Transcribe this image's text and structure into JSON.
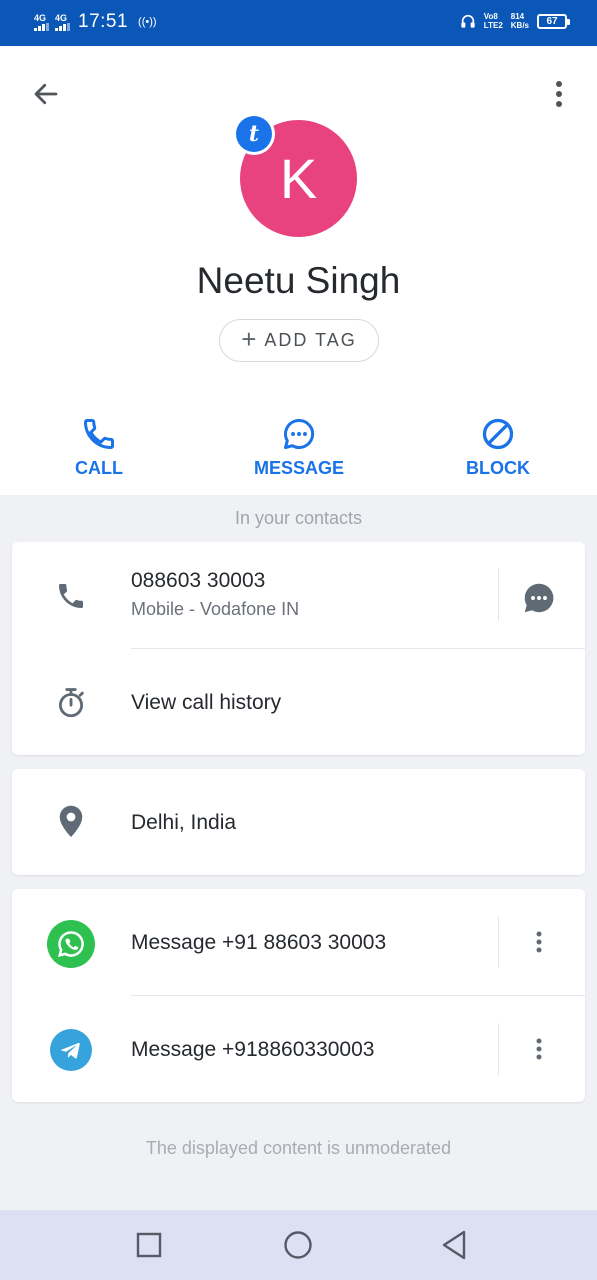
{
  "status_bar": {
    "network1": "4G",
    "network2": "4G",
    "time": "17:51",
    "volte": "Vo8",
    "lte": "LTE2",
    "speed": "814",
    "speed_unit": "KB/s",
    "battery": "67"
  },
  "contact": {
    "avatar_letter": "K",
    "badge_letter": "t",
    "name": "Neetu Singh",
    "add_tag_label": "ADD TAG"
  },
  "actions": {
    "call_label": "CALL",
    "message_label": "MESSAGE",
    "block_label": "BLOCK"
  },
  "in_contacts_label": "In your contacts",
  "phone": {
    "number": "088603 30003",
    "detail": "Mobile - Vodafone IN"
  },
  "call_history_label": "View call history",
  "location": "Delhi, India",
  "messaging": {
    "whatsapp_label": "Message +91 88603 30003",
    "telegram_label": "Message +918860330003"
  },
  "footer_text": "The displayed content is unmoderated",
  "colors": {
    "status_bar": "#0b57b7",
    "accent": "#1a73e8",
    "avatar": "#e8437e",
    "whatsapp": "#2fc14f",
    "telegram": "#37a3dd",
    "navbar": "#dde0f2"
  }
}
